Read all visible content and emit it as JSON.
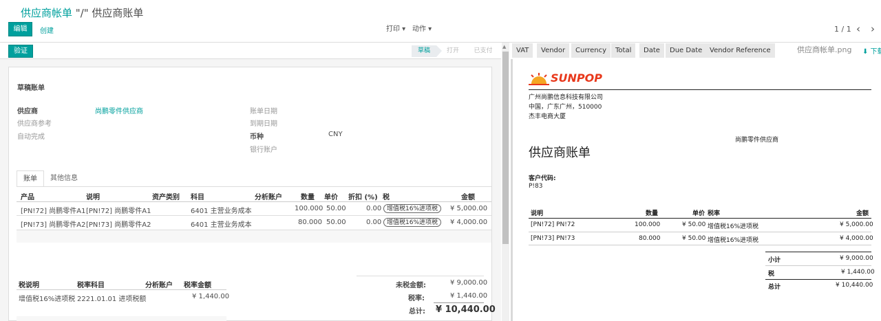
{
  "breadcrumb": {
    "parent": "供应商帐单",
    "current": "\"/\" 供应商账单"
  },
  "toolbar": {
    "edit_label": "编辑",
    "create_label": "创建",
    "print_label": "打印 ▾",
    "action_label": "动作 ▾",
    "pager_text": "1 / 1",
    "prev": "‹",
    "next": "›"
  },
  "statusbar": {
    "validate_label": "验证",
    "stages": [
      "草稿",
      "打开",
      "已支付"
    ]
  },
  "form": {
    "title": "草稿账单",
    "vendor_label": "供应商",
    "vendor_value": "尚鹏零件供应商",
    "vendor_ref_label": "供应商参考",
    "auto_complete_label": "自动完成",
    "bill_date_label": "账单日期",
    "due_date_label": "到期日期",
    "currency_label": "币种",
    "currency_value": "CNY",
    "bank_label": "银行账户"
  },
  "tabs": [
    "账单",
    "其他信息"
  ],
  "lines": {
    "headers": [
      "产品",
      "说明",
      "资产类别",
      "科目",
      "分析账户",
      "数量",
      "单价",
      "折扣 (%)",
      "税",
      "金额"
    ],
    "rows": [
      {
        "product": "[PN!72] 尚鹏零件A1",
        "desc": "[PN!72] 尚鹏零件A1",
        "account": "6401 主营业务成本",
        "qty": "100.000",
        "price": "50.00",
        "discount": "0.00",
        "tax": "增值税16%进项税",
        "amount": "¥ 5,000.00"
      },
      {
        "product": "[PN!73] 尚鹏零件A2",
        "desc": "[PN!73] 尚鹏零件A2",
        "account": "6401 主营业务成本",
        "qty": "80.000",
        "price": "50.00",
        "discount": "0.00",
        "tax": "增值税16%进项税",
        "amount": "¥ 4,000.00"
      }
    ]
  },
  "tax_table": {
    "headers": [
      "税说明",
      "税率科目",
      "分析账户",
      "税率金额"
    ],
    "row": {
      "desc": "增值税16%进项税",
      "account": "2221.01.01 进项税额",
      "amount": "¥ 1,440.00"
    }
  },
  "totals": {
    "untaxed_label": "未税金额:",
    "untaxed_value": "¥ 9,000.00",
    "tax_label": "税率:",
    "tax_value": "¥ 1,440.00",
    "total_label": "总计:",
    "total_value": "¥ 10,440.00"
  },
  "preview_columns": [
    "VAT",
    "Vendor",
    "Currency",
    "Total",
    "Date",
    "Due Date",
    "Vendor Reference"
  ],
  "file": {
    "name": "供应商帐单.png",
    "download_label": "⬇ 下载"
  },
  "report": {
    "logo": "SUNPOP",
    "company": "广州尚鹏信息科技有限公司",
    "address1": "中国，广东广州，510000",
    "address2": "杰丰电商大厦",
    "partner": "尚鹏零件供应商",
    "title": "供应商账单",
    "customer_code_label": "客户代码:",
    "customer_code": "P!83",
    "headers": [
      "说明",
      "数量",
      "单价",
      "税率",
      "金额"
    ],
    "rows": [
      {
        "desc": "[PN!72] PN!72",
        "qty": "100.000",
        "price": "¥ 50.00",
        "tax": "增值税16%进项税",
        "amount": "¥ 5,000.00"
      },
      {
        "desc": "[PN!73] PN!73",
        "qty": "80.000",
        "price": "¥ 50.00",
        "tax": "增值税16%进项税",
        "amount": "¥ 4,000.00"
      }
    ],
    "subtotal_label": "小计",
    "subtotal_value": "¥ 9,000.00",
    "tax_label": "税",
    "tax_value": "¥ 1,440.00",
    "total_label": "总计",
    "total_value": "¥ 10,440.00"
  },
  "colors": {
    "accent": "#00a09d",
    "logo": "#e8381b"
  }
}
